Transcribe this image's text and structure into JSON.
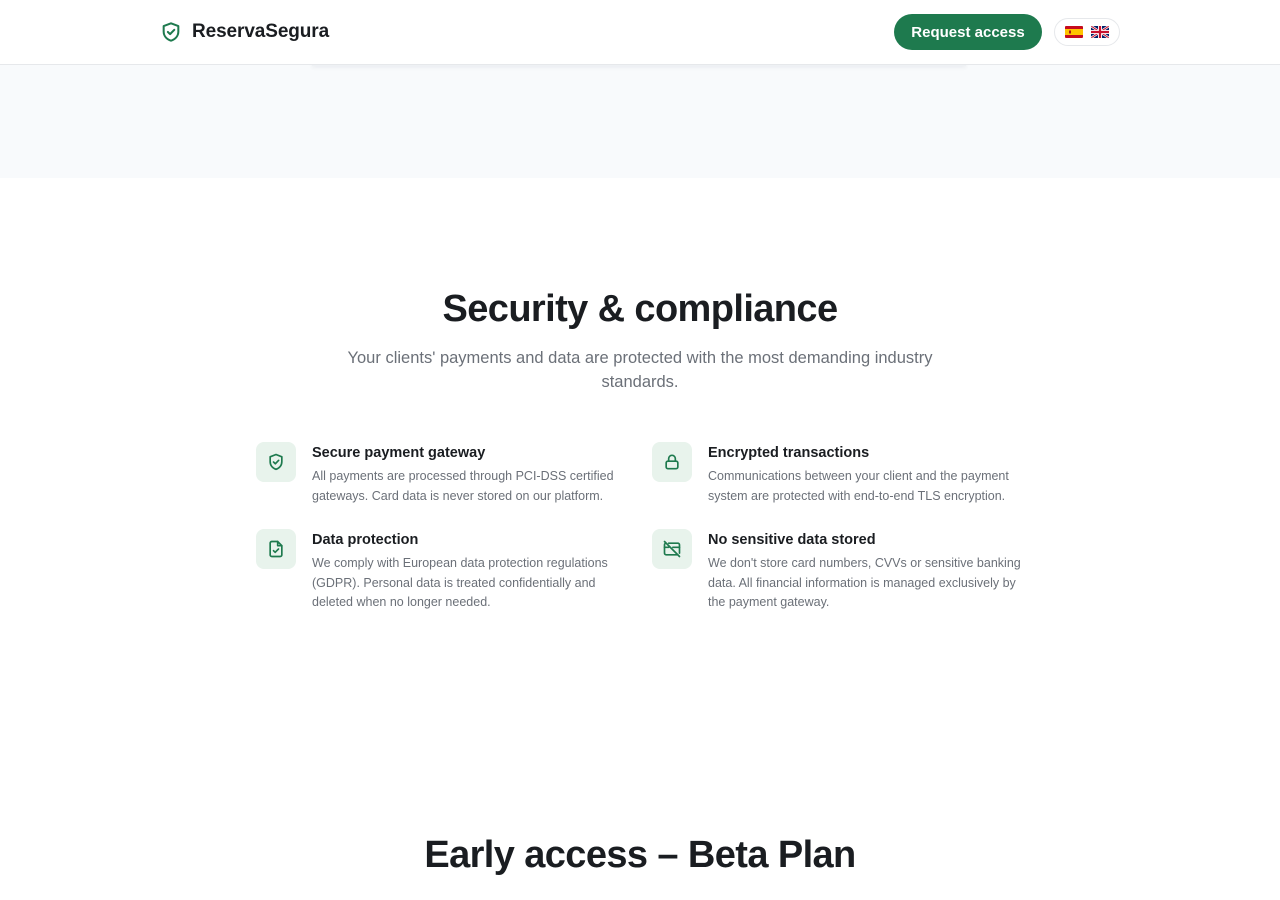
{
  "header": {
    "brand_name": "ReservaSegura",
    "cta_label": "Request access",
    "languages": [
      {
        "code": "es",
        "icon": "flag-spain-icon"
      },
      {
        "code": "en",
        "icon": "flag-uk-icon"
      }
    ]
  },
  "security": {
    "title": "Security & compliance",
    "subtitle": "Your clients' payments and data are protected with the most demanding industry standards.",
    "features": [
      {
        "icon": "shield-check-icon",
        "title": "Secure payment gateway",
        "description": "All payments are processed through PCI-DSS certified gateways. Card data is never stored on our platform."
      },
      {
        "icon": "lock-icon",
        "title": "Encrypted transactions",
        "description": "Communications between your client and the payment system are protected with end-to-end TLS encryption."
      },
      {
        "icon": "file-check-icon",
        "title": "Data protection",
        "description": "We comply with European data protection regulations (GDPR). Personal data is treated confidentially and deleted when no longer needed."
      },
      {
        "icon": "card-off-icon",
        "title": "No sensitive data stored",
        "description": "We don't store card numbers, CVVs or sensitive banking data. All financial information is managed exclusively by the payment gateway."
      }
    ]
  },
  "beta": {
    "title": "Early access – Beta Plan"
  },
  "colors": {
    "brand": "#1e7a4e",
    "icon_bg": "#e8f3ec",
    "text": "#1a1d21",
    "muted": "#6b7078"
  }
}
